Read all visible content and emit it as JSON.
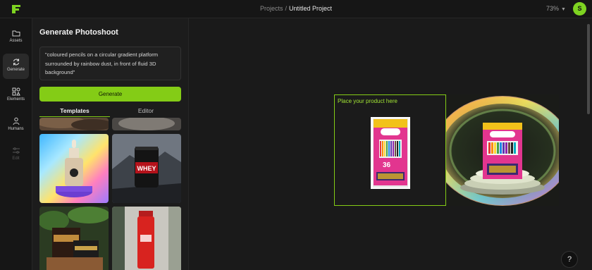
{
  "header": {
    "breadcrumb_root": "Projects",
    "breadcrumb_sep": "/",
    "project_name": "Untitled Project",
    "zoom": "73%",
    "avatar_initial": "S"
  },
  "rail": {
    "items": [
      {
        "label": "Assets",
        "icon": "folder-icon"
      },
      {
        "label": "Generate",
        "icon": "refresh-icon"
      },
      {
        "label": "Elements",
        "icon": "shapes-icon"
      },
      {
        "label": "Humans",
        "icon": "person-icon"
      },
      {
        "label": "Edit",
        "icon": "sliders-icon"
      }
    ]
  },
  "panel": {
    "title": "Generate Photoshoot",
    "prompt": "\"coloured pencils on a circular gradient platform surrounded by rainbow dust, in front of fluid 3D background\"",
    "generate_label": "Generate",
    "tabs": [
      "Templates",
      "Editor"
    ]
  },
  "templates": {
    "whey_text": "WHEY"
  },
  "canvas": {
    "placeholder_label": "Place your product here",
    "product_count_text": "36",
    "help_label": "?"
  },
  "colors": {
    "accent": "#84cc16",
    "accent_text": "#a3e635",
    "background": "#1a1a1a"
  }
}
